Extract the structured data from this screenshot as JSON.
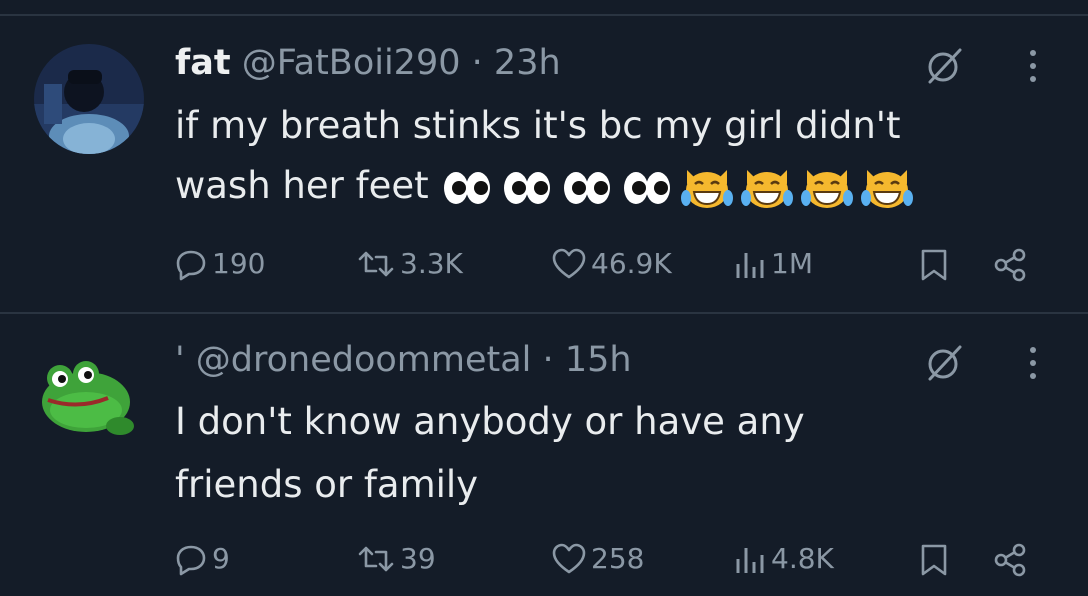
{
  "posts": [
    {
      "display_name": "fat",
      "handle": "@FatBoii290",
      "separator": "·",
      "time": "23h",
      "text_line1": "if my breath stinks it's bc my girl didn't",
      "text_line2": "wash her feet",
      "emojis": [
        "eyes",
        "eyes",
        "eyes",
        "eyes",
        "joy-cat",
        "joy-cat",
        "joy-cat",
        "joy-cat"
      ],
      "metrics": {
        "replies": "190",
        "reposts": "3.3K",
        "likes": "46.9K",
        "views": "1M"
      }
    },
    {
      "display_name_fragment": "'",
      "handle": "@dronedoommetal",
      "separator": "·",
      "time": "15h",
      "text_line1": "I don't know anybody or have any",
      "text_line2": "friends or family",
      "metrics": {
        "replies": "9",
        "reposts": "39",
        "likes": "258",
        "views": "4.8K"
      }
    }
  ],
  "icons": {
    "grok": "grok-icon",
    "more": "more-options-icon",
    "reply": "reply-icon",
    "repost": "repost-icon",
    "like": "like-icon",
    "views": "views-icon",
    "bookmark": "bookmark-icon",
    "share": "share-icon"
  },
  "colors": {
    "background": "#141c28",
    "muted": "#8b98a5",
    "text": "#e7e9ea",
    "divider": "#2a3441"
  }
}
